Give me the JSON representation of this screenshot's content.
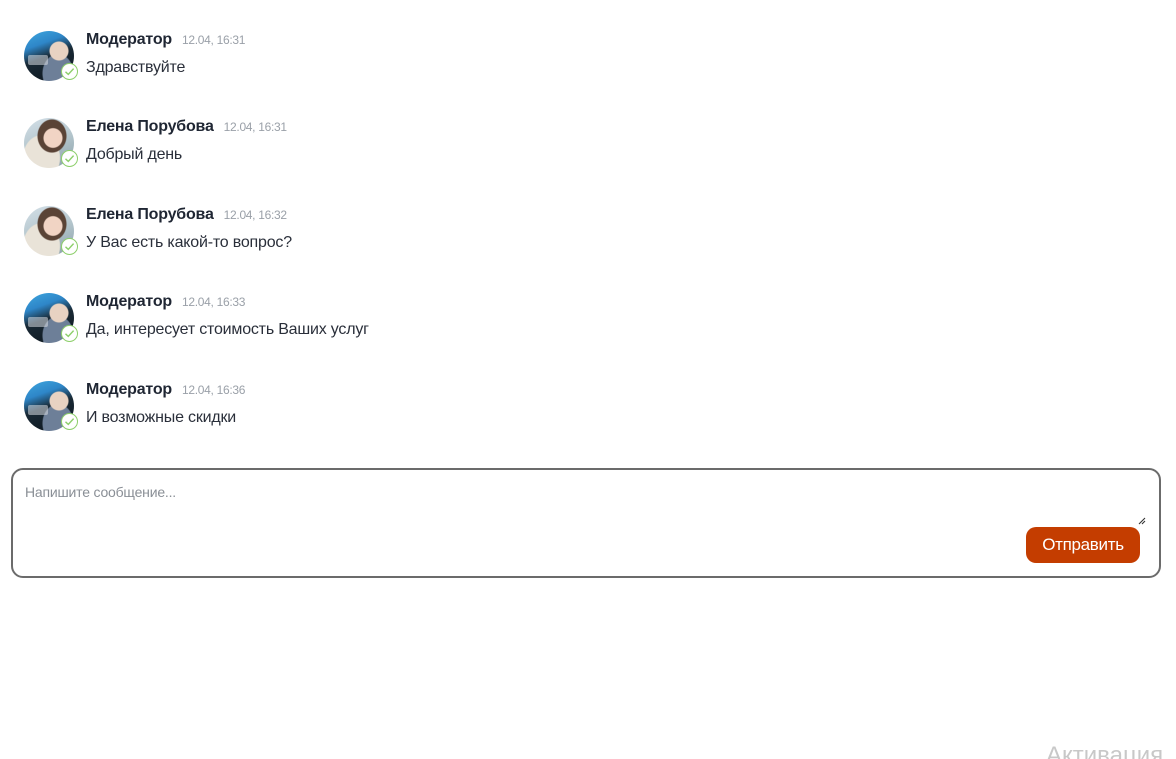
{
  "messages": [
    {
      "author": "Модератор",
      "time": "12.04, 16:31",
      "text": "Здравствуйте",
      "avatar": "moderator-avatar"
    },
    {
      "author": "Елена Порубова",
      "time": "12.04, 16:31",
      "text": "Добрый день",
      "avatar": "elena-avatar"
    },
    {
      "author": "Елена Порубова",
      "time": "12.04, 16:32",
      "text": "У Вас есть какой-то вопрос?",
      "avatar": "elena-avatar"
    },
    {
      "author": "Модератор",
      "time": "12.04, 16:33",
      "text": "Да, интересует стоимость Ваших услуг",
      "avatar": "moderator-avatar"
    },
    {
      "author": "Модератор",
      "time": "12.04, 16:36",
      "text": "И возможные скидки",
      "avatar": "moderator-avatar"
    }
  ],
  "composer": {
    "placeholder": "Напишите сообщение...",
    "value": "",
    "send_label": "Отправить"
  },
  "watermark": "Активация",
  "colors": {
    "send_button": "#c43d00",
    "check_badge": "#8dcf6b",
    "border": "#6b6b6b"
  }
}
